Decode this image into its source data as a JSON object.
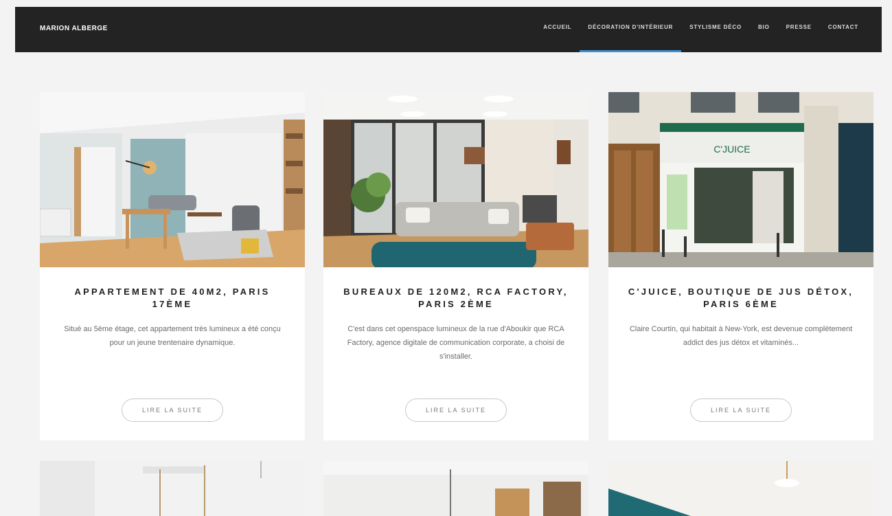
{
  "header": {
    "brand": "MARION ALBERGE",
    "menu": [
      {
        "label": "ACCUEIL",
        "active": false
      },
      {
        "label": "DÉCORATION D'INTÉRIEUR",
        "active": true
      },
      {
        "label": "STYLISME DÉCO",
        "active": false
      },
      {
        "label": "BIO",
        "active": false
      },
      {
        "label": "PRESSE",
        "active": false
      },
      {
        "label": "CONTACT",
        "active": false
      }
    ]
  },
  "cards": [
    {
      "title": "APPARTEMENT DE 40M2, PARIS 17ÈME",
      "excerpt": "Situé au 5ème étage, cet appartement très lumineux a été conçu pour un jeune trentenaire dynamique.",
      "button": "LIRE LA SUITE"
    },
    {
      "title": "BUREAUX DE 120M2, RCA FACTORY, PARIS 2ÈME",
      "excerpt": "C'est dans cet openspace lumineux de la rue d'Aboukir que RCA Factory, agence digitale de communication corporate, a choisi de s'installer.",
      "button": "LIRE LA SUITE"
    },
    {
      "title": "C'JUICE, BOUTIQUE DE JUS DÉTOX, PARIS 6ÈME",
      "excerpt": "Claire Courtin, qui habitait à New-York, est devenue complètement addict des jus détox et vitaminés...",
      "button": "LIRE LA SUITE",
      "sign": "C'JUICE"
    }
  ],
  "colors": {
    "nav_bg": "#232323",
    "active_underline": "#3e8fd0",
    "page_bg": "#f3f3f3"
  }
}
